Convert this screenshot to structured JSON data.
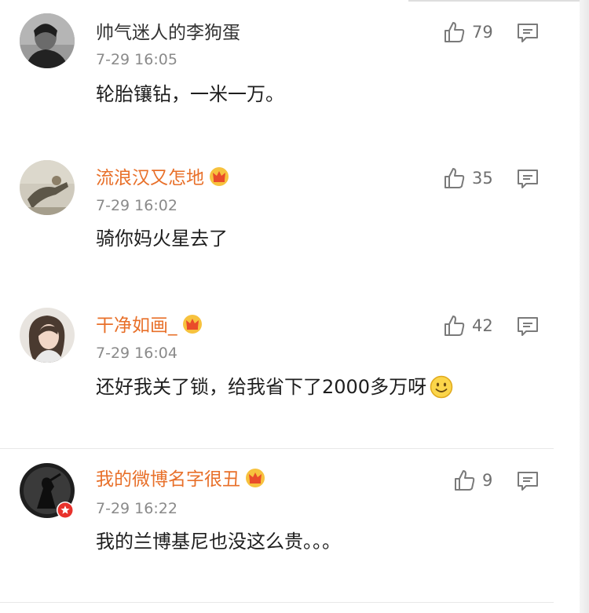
{
  "colors": {
    "vip_name": "#e8702a",
    "plain_name": "#333333",
    "meta_text": "#8a8a8a",
    "body_text": "#1e1e1e"
  },
  "comments": [
    {
      "username": "帅气迷人的李狗蛋",
      "vip": false,
      "timestamp": "7-29 16:05",
      "text": "轮胎镶钻，一米一万。",
      "likes": "79",
      "icons": [
        "thumbs-up-icon",
        "reply-icon"
      ]
    },
    {
      "username": "流浪汉又怎地",
      "vip": true,
      "timestamp": "7-29 16:02",
      "text": "骑你妈火星去了",
      "likes": "35",
      "icons": [
        "crown-icon",
        "thumbs-up-icon",
        "reply-icon"
      ]
    },
    {
      "username": "干净如画_",
      "vip": true,
      "timestamp": "7-29 16:04",
      "text": "还好我关了锁，给我省下了2000多万呀",
      "emoji": "smile-emoji",
      "likes": "42",
      "icons": [
        "crown-icon",
        "thumbs-up-icon",
        "reply-icon"
      ]
    },
    {
      "username": "我的微博名字很丑",
      "vip": true,
      "timestamp": "7-29 16:22",
      "text": "我的兰博基尼也没这么贵。。。",
      "likes": "9",
      "icons": [
        "crown-icon",
        "verified-badge-icon",
        "thumbs-up-icon",
        "reply-icon"
      ]
    }
  ]
}
